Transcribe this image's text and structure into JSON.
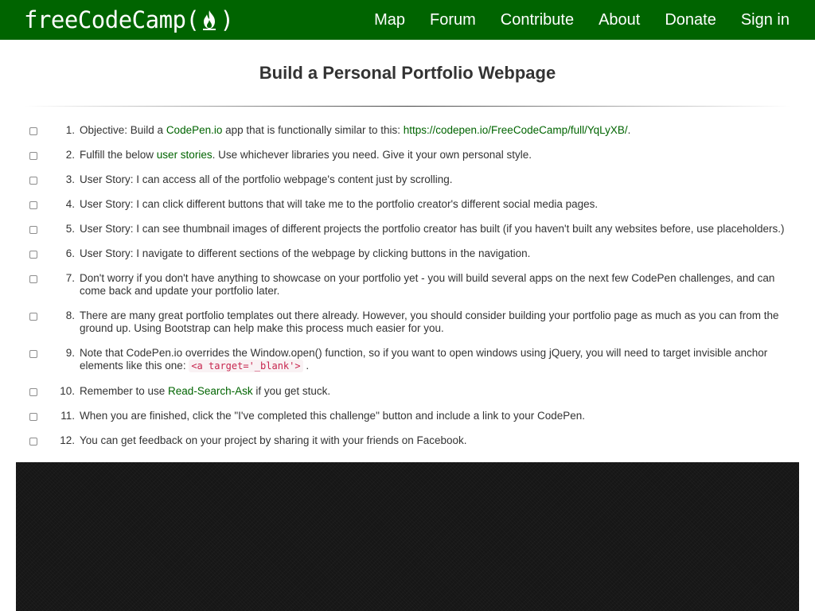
{
  "brand": {
    "name": "freeCodeCamp",
    "open": "(",
    "close": ")"
  },
  "nav": {
    "links": [
      {
        "label": "Map"
      },
      {
        "label": "Forum"
      },
      {
        "label": "Contribute"
      },
      {
        "label": "About"
      },
      {
        "label": "Donate"
      },
      {
        "label": "Sign in"
      }
    ]
  },
  "page": {
    "title": "Build a Personal Portfolio Webpage"
  },
  "items": [
    {
      "num": "1.",
      "pre": "Objective: Build a ",
      "link1": "CodePen.io",
      "mid": " app that is functionally similar to this: ",
      "link2": "https://codepen.io/FreeCodeCamp/full/YqLyXB/",
      "post": "."
    },
    {
      "num": "2.",
      "pre": "Fulfill the below ",
      "link": "user stories",
      "post": ". Use whichever libraries you need. Give it your own personal style."
    },
    {
      "num": "3.",
      "text": "User Story: I can access all of the portfolio webpage's content just by scrolling."
    },
    {
      "num": "4.",
      "text": "User Story: I can click different buttons that will take me to the portfolio creator's different social media pages."
    },
    {
      "num": "5.",
      "text": "User Story: I can see thumbnail images of different projects the portfolio creator has built (if you haven't built any websites before, use placeholders.)"
    },
    {
      "num": "6.",
      "text": "User Story: I navigate to different sections of the webpage by clicking buttons in the navigation."
    },
    {
      "num": "7.",
      "text": "Don't worry if you don't have anything to showcase on your portfolio yet - you will build several apps on the next few CodePen challenges, and can come back and update your portfolio later."
    },
    {
      "num": "8.",
      "text": "There are many great portfolio templates out there already. However, you should consider building your portfolio page as much as you can from the ground up. Using Bootstrap can help make this process much easier for you."
    },
    {
      "num": "9.",
      "pre": "Note that CodePen.io overrides the Window.open() function, so if you want to open windows using jQuery, you will need to target invisible anchor elements like this one: ",
      "code": "<a target='_blank'>",
      "post": "."
    },
    {
      "num": "10.",
      "pre": "Remember to use ",
      "link": "Read-Search-Ask",
      "post": " if you get stuck."
    },
    {
      "num": "11.",
      "text": "When you are finished, click the \"I've completed this challenge\" button and include a link to your CodePen."
    },
    {
      "num": "12.",
      "text": "You can get feedback on your project by sharing it with your friends on Facebook."
    }
  ],
  "colors": {
    "nav_bg": "#006400",
    "link": "#006400",
    "code": "#c7254e",
    "preview_bg": "#161616"
  },
  "icons": {
    "brand": "flame-icon"
  }
}
